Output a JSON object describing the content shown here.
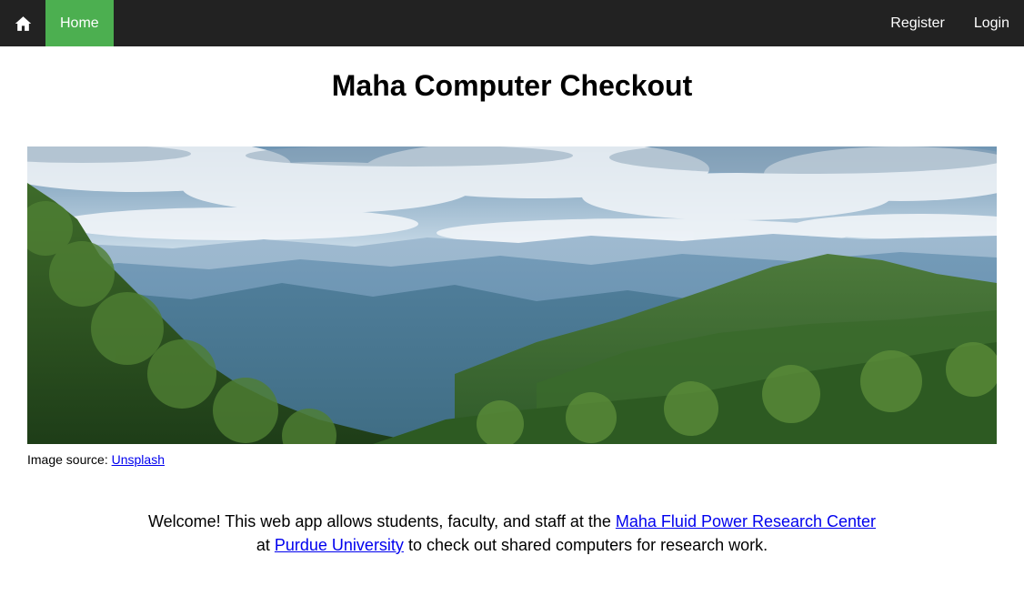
{
  "nav": {
    "home_icon": "home-icon",
    "home_label": "Home",
    "register_label": "Register",
    "login_label": "Login",
    "active_color": "#4caf50",
    "bar_color": "#222222"
  },
  "page": {
    "title": "Maha Computer Checkout"
  },
  "hero": {
    "caption_prefix": "Image source:",
    "caption_link": "Unsplash"
  },
  "welcome": {
    "text_1": "Welcome! This web app allows students, faculty, and staff at the",
    "link_1": "Maha Fluid Power Research Center",
    "text_2": "at",
    "link_2": "Purdue University",
    "text_3": "to check out shared computers for research work."
  },
  "colors": {
    "link": "#0000ee"
  }
}
